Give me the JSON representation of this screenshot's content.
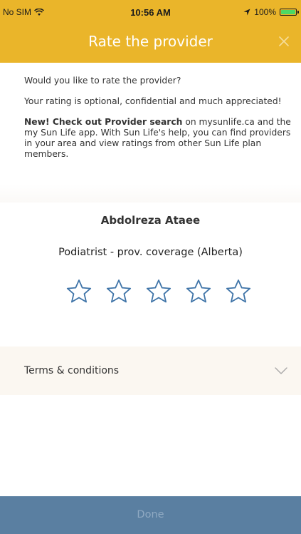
{
  "status_bar": {
    "carrier": "No SIM",
    "time": "10:56 AM",
    "battery": "100%",
    "battery_level": 1.0
  },
  "header": {
    "title": "Rate the provider",
    "close_icon": "close-icon",
    "background_color": "#eab52a"
  },
  "intro": {
    "question": "Would you like to rate the provider?",
    "optional_note": "Your rating is optional, confidential and much appreciated!",
    "new_label": "New! Check out Provider search",
    "new_body": " on mysunlife.ca and the my Sun Life app. With Sun Life's help, you can find providers in your area and view ratings from other Sun Life plan members."
  },
  "provider": {
    "name": "Abdolreza Ataee",
    "type": "Podiatrist - prov. coverage (Alberta)"
  },
  "rating": {
    "max_stars": 5,
    "selected": 0,
    "star_color": "#3f74a8"
  },
  "terms": {
    "label": "Terms & conditions",
    "icon": "chevron-down-icon"
  },
  "footer": {
    "done_label": "Done",
    "background_color": "#5a7fa1"
  }
}
